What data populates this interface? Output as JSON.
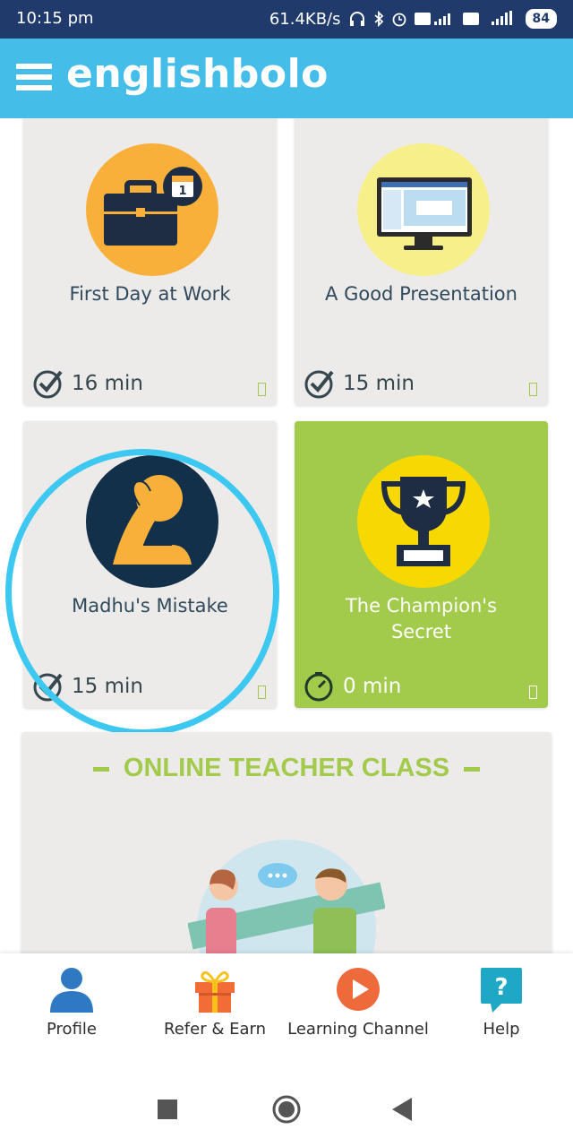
{
  "status_bar": {
    "time": "10:15 pm",
    "speed": "61.4KB/s",
    "battery": "84"
  },
  "app": {
    "brand": "englishbolo",
    "accent": "#45bde9",
    "green": "#a2cb4c"
  },
  "lessons": [
    {
      "title": "First Day at Work",
      "duration": "16 min",
      "icon": "briefcase-calendar-icon"
    },
    {
      "title": "A Good Presentation",
      "duration": "15 min",
      "icon": "monitor-icon"
    },
    {
      "title": "Madhu's Mistake",
      "duration": "15 min",
      "icon": "facepalm-icon"
    },
    {
      "title": "The Champion's Secret",
      "duration": "0 min",
      "icon": "trophy-icon"
    }
  ],
  "teacher_class": {
    "title": "ONLINE TEACHER CLASS"
  },
  "bottom_nav": [
    {
      "label": "Profile",
      "icon": "person-icon"
    },
    {
      "label": "Refer & Earn",
      "icon": "gift-icon"
    },
    {
      "label": "Learning Channel",
      "icon": "play-icon"
    },
    {
      "label": "Help",
      "icon": "help-icon"
    }
  ]
}
